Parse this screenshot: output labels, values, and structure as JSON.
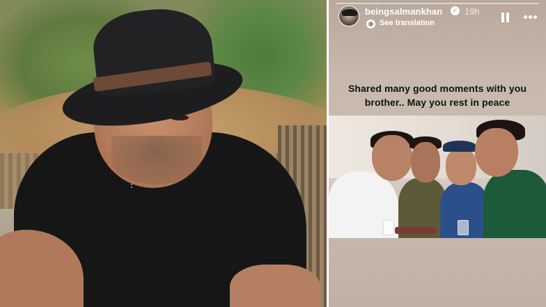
{
  "left_photo": {
    "subject": "man-in-black-hat-photo"
  },
  "story": {
    "username": "beingsalmankhan",
    "verified_badge": "✓",
    "time_ago": "19h",
    "see_translation": "See translation",
    "caption": "Shared many good moments with you brother.. May  you rest in peace",
    "progress": 0.0,
    "icons": {
      "avatar": "avatar",
      "verified": "verified-icon",
      "translate": "translate-icon",
      "pause": "pause-icon",
      "more": "more-icon"
    },
    "colors": {
      "background": "#c8b9ad",
      "caption_text": "#111111",
      "header_text": "#ffffff"
    }
  }
}
